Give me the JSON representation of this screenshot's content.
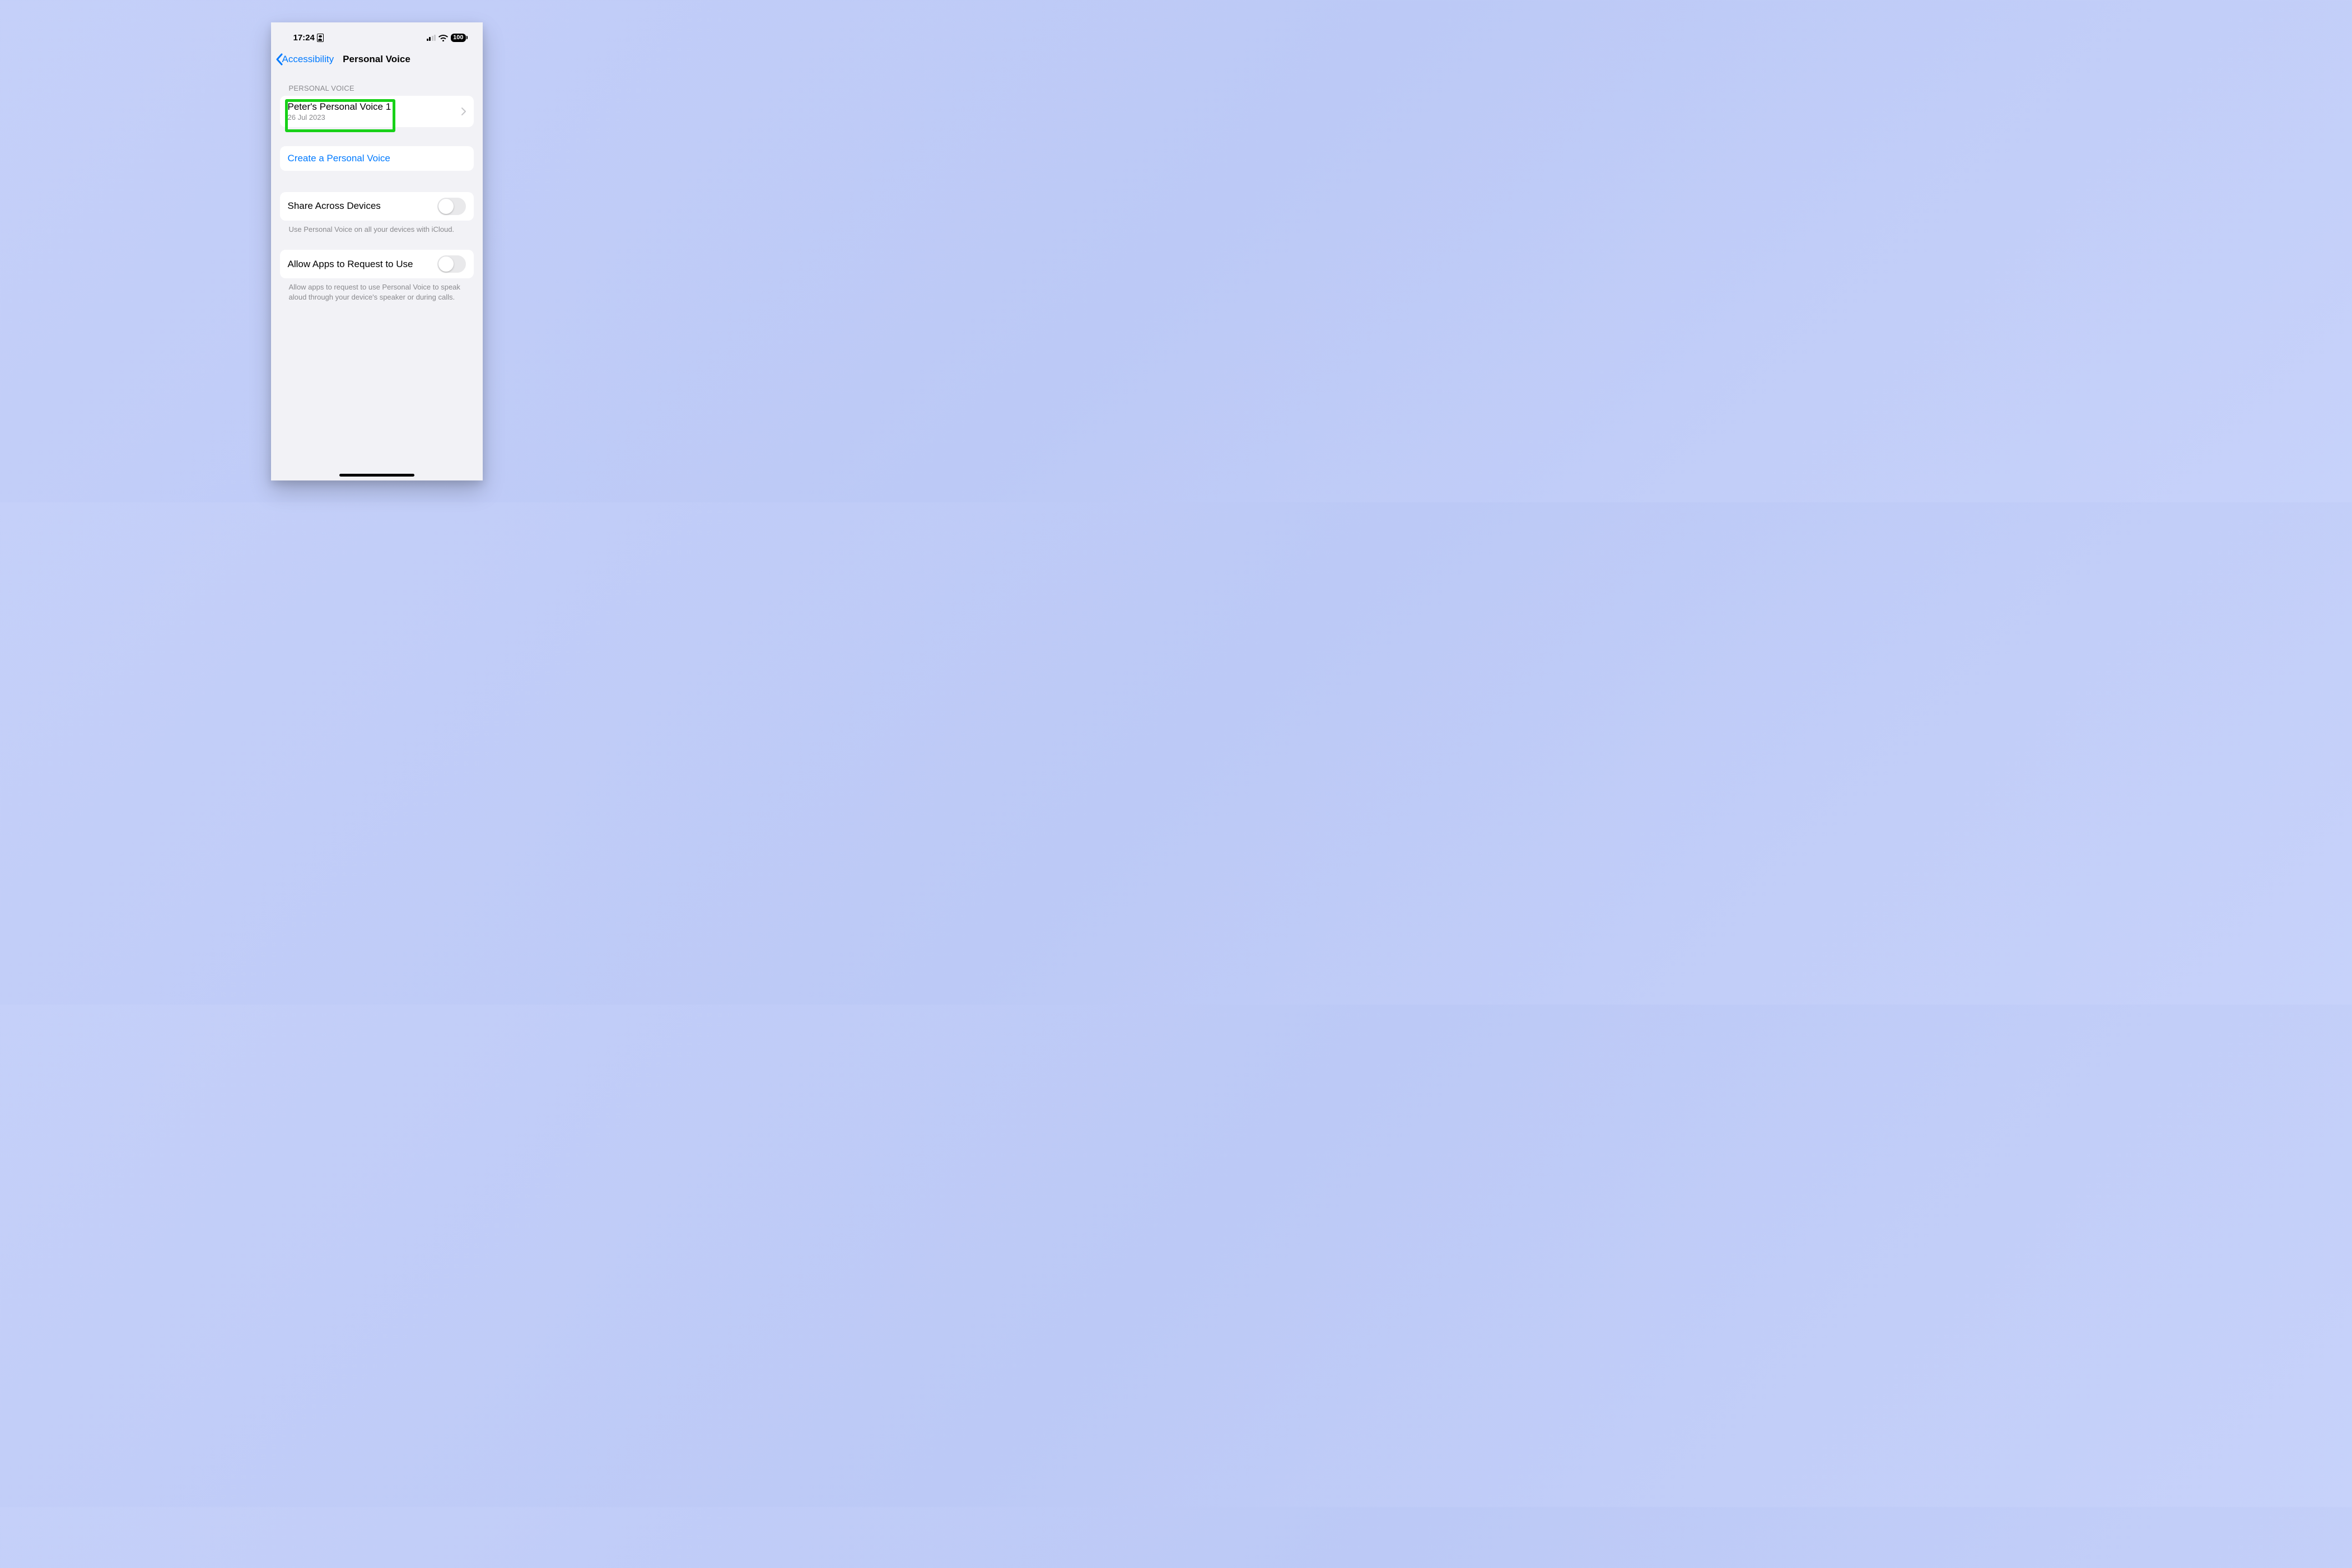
{
  "status": {
    "time": "17:24",
    "battery": "100"
  },
  "nav": {
    "back_label": "Accessibility",
    "title": "Personal Voice"
  },
  "section1": {
    "header": "PERSONAL VOICE",
    "voice_name": "Peter's Personal Voice 1",
    "voice_date": "26 Jul 2023"
  },
  "create": {
    "label": "Create a Personal Voice"
  },
  "share": {
    "label": "Share Across Devices",
    "footer": "Use Personal Voice on all your devices with iCloud."
  },
  "allow": {
    "label": "Allow Apps to Request to Use",
    "footer": "Allow apps to request to use Personal Voice to speak aloud through your device's speaker or during calls."
  },
  "colors": {
    "link": "#007aff",
    "highlight": "#18d118"
  }
}
